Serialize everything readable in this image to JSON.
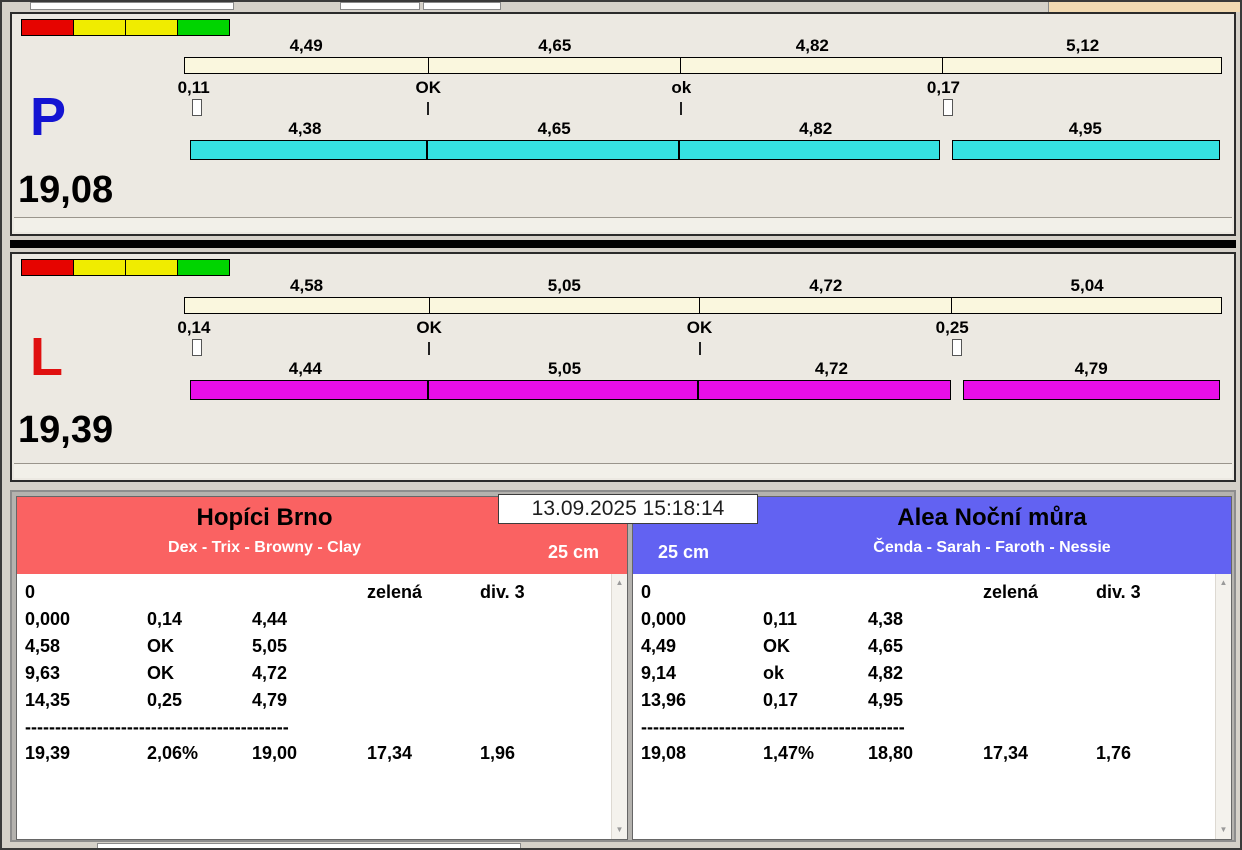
{
  "timestamp": "13.09.2025 15:18:14",
  "lights": [
    "#E60400",
    "#F0EC00",
    "#F0EC00",
    "#00D400"
  ],
  "lanes": [
    {
      "letter": "P",
      "letter_color": "#1414D2",
      "total": "19,08",
      "bar_color": "#35E2E2",
      "splits_top": [
        "4,49",
        "4,65",
        "4,82",
        "5,12"
      ],
      "marks": [
        "0,11",
        "OK",
        "ok",
        "0,17"
      ],
      "splits_bottom": [
        "4,38",
        "4,65",
        "4,82",
        "4,95"
      ]
    },
    {
      "letter": "L",
      "letter_color": "#E01010",
      "total": "19,39",
      "bar_color": "#E80EE8",
      "splits_top": [
        "4,58",
        "5,05",
        "4,72",
        "5,04"
      ],
      "marks": [
        "0,14",
        "OK",
        "OK",
        "0,25"
      ],
      "splits_bottom": [
        "4,44",
        "5,05",
        "4,72",
        "4,79"
      ]
    }
  ],
  "teams": [
    {
      "name": "Hopíci Brno",
      "lineup": "Dex - Trix - Browny - Clay",
      "height": "25 cm",
      "header_color": "#FA6262",
      "rows": [
        [
          "0",
          "",
          "",
          "zelená",
          "div. 3"
        ],
        [
          "0,000",
          "0,14",
          "4,44",
          "",
          ""
        ],
        [
          "4,58",
          "OK",
          "5,05",
          "",
          ""
        ],
        [
          "9,63",
          "OK",
          "4,72",
          "",
          ""
        ],
        [
          "14,35",
          "0,25",
          "4,79",
          "",
          ""
        ]
      ],
      "separator": "--------------------------------------------",
      "totals": [
        "19,39",
        "2,06%",
        "19,00",
        "17,34",
        "1,96"
      ]
    },
    {
      "name": "Alea Noční můra",
      "lineup": "Čenda - Sarah - Faroth - Nessie",
      "height": "25 cm",
      "header_color": "#6262F2",
      "rows": [
        [
          "0",
          "",
          "",
          "zelená",
          "div. 3"
        ],
        [
          "0,000",
          "0,11",
          "4,38",
          "",
          ""
        ],
        [
          "4,49",
          "OK",
          "4,65",
          "",
          ""
        ],
        [
          "9,14",
          "ok",
          "4,82",
          "",
          ""
        ],
        [
          "13,96",
          "0,17",
          "4,95",
          "",
          ""
        ]
      ],
      "separator": "--------------------------------------------",
      "totals": [
        "19,08",
        "1,47%",
        "18,80",
        "17,34",
        "1,76"
      ]
    }
  ]
}
